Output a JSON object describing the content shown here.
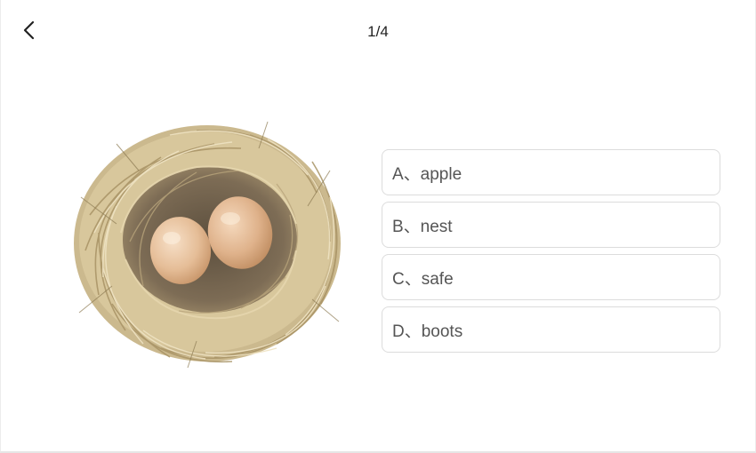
{
  "header": {
    "back_icon": "chevron-left-icon",
    "progress": "1/4"
  },
  "question": {
    "image_subject": "bird-nest-with-two-eggs"
  },
  "options": [
    {
      "label": "A、apple"
    },
    {
      "label": "B、nest"
    },
    {
      "label": "C、safe"
    },
    {
      "label": "D、boots"
    }
  ],
  "colors": {
    "option_border": "#dcdcdc",
    "option_text": "#555555",
    "egg": "#e8c3a0",
    "straw": "#c9b68a"
  }
}
